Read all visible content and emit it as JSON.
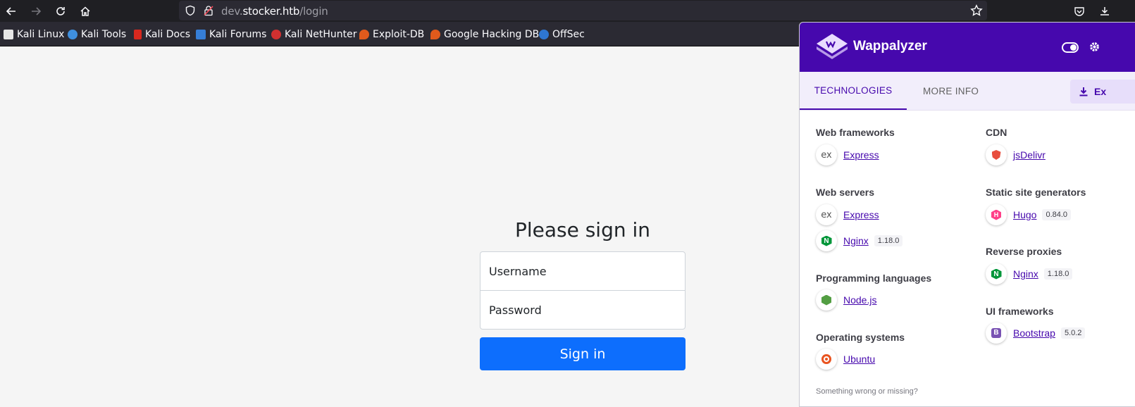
{
  "browser": {
    "url_host_prefix": "dev.",
    "url_host_main": "stocker.htb",
    "url_path": "/login",
    "bookmarks": [
      {
        "label": "Kali Linux",
        "color": "#e6e6e6"
      },
      {
        "label": "Kali Tools",
        "color": "#3f8fde"
      },
      {
        "label": "Kali Docs",
        "color": "#d9281e"
      },
      {
        "label": "Kali Forums",
        "color": "#367ed7"
      },
      {
        "label": "Kali NetHunter",
        "color": "#d13030"
      },
      {
        "label": "Exploit-DB",
        "color": "#e05a1c"
      },
      {
        "label": "Google Hacking DB",
        "color": "#e05a1c"
      },
      {
        "label": "OffSec",
        "color": "#2e76d1"
      }
    ]
  },
  "login": {
    "heading": "Please sign in",
    "username_placeholder": "Username",
    "password_placeholder": "Password",
    "submit_label": "Sign in",
    "accent": "#0d6efd"
  },
  "wappalyzer": {
    "brand": "Wappalyzer",
    "accent": "#4608ad",
    "tabs": {
      "technologies": "TECHNOLOGIES",
      "more_info": "MORE INFO"
    },
    "export_label": "Ex",
    "categories_left": [
      {
        "title": "Web frameworks",
        "items": [
          {
            "name": "Express",
            "version": "",
            "icon": "express-icon"
          }
        ]
      },
      {
        "title": "Web servers",
        "items": [
          {
            "name": "Express",
            "version": "",
            "icon": "express-icon"
          },
          {
            "name": "Nginx",
            "version": "1.18.0",
            "icon": "nginx-icon"
          }
        ]
      },
      {
        "title": "Programming languages",
        "items": [
          {
            "name": "Node.js",
            "version": "",
            "icon": "nodejs-icon"
          }
        ]
      },
      {
        "title": "Operating systems",
        "items": [
          {
            "name": "Ubuntu",
            "version": "",
            "icon": "ubuntu-icon"
          }
        ]
      }
    ],
    "categories_right": [
      {
        "title": "CDN",
        "items": [
          {
            "name": "jsDelivr",
            "version": "",
            "icon": "jsdelivr-icon"
          }
        ]
      },
      {
        "title": "Static site generators",
        "items": [
          {
            "name": "Hugo",
            "version": "0.84.0",
            "icon": "hugo-icon"
          }
        ]
      },
      {
        "title": "Reverse proxies",
        "items": [
          {
            "name": "Nginx",
            "version": "1.18.0",
            "icon": "nginx-icon"
          }
        ]
      },
      {
        "title": "UI frameworks",
        "items": [
          {
            "name": "Bootstrap",
            "version": "5.0.2",
            "icon": "bootstrap-icon"
          }
        ]
      }
    ],
    "footer": "Something wrong or missing?"
  }
}
